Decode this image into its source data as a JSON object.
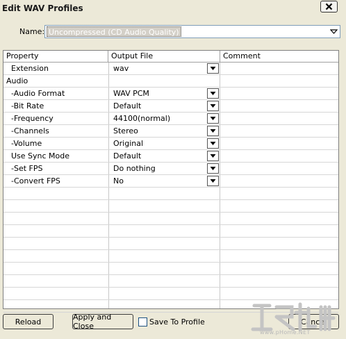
{
  "window": {
    "title": "Edit WAV Profiles"
  },
  "name_field": {
    "label": "Name:",
    "value": "Uncompressed (CD Audio Quality)"
  },
  "grid": {
    "columns": [
      "Property",
      "Output File",
      "Comment"
    ],
    "rows": [
      {
        "property": "Extension",
        "value": "wav",
        "indent": true,
        "dropdown": true
      },
      {
        "property": "Audio",
        "value": "",
        "indent": false,
        "dropdown": false
      },
      {
        "property": "-Audio Format",
        "value": "WAV PCM",
        "indent": true,
        "dropdown": true
      },
      {
        "property": "-Bit Rate",
        "value": "Default",
        "indent": true,
        "dropdown": true
      },
      {
        "property": "-Frequency",
        "value": "44100(normal)",
        "indent": true,
        "dropdown": true
      },
      {
        "property": "-Channels",
        "value": "Stereo",
        "indent": true,
        "dropdown": true
      },
      {
        "property": "-Volume",
        "value": "Original",
        "indent": true,
        "dropdown": true
      },
      {
        "property": "Use Sync Mode",
        "value": "Default",
        "indent": true,
        "dropdown": true
      },
      {
        "property": "-Set FPS",
        "value": "Do nothing",
        "indent": true,
        "dropdown": true
      },
      {
        "property": "-Convert FPS",
        "value": "No",
        "indent": true,
        "dropdown": true
      }
    ]
  },
  "buttons": {
    "reload": "Reload",
    "apply_close": "Apply and Close",
    "save_to_profile": "Save To Profile",
    "cancel": "Cancel"
  },
  "watermark": {
    "text": "www.pHome.NET"
  }
}
